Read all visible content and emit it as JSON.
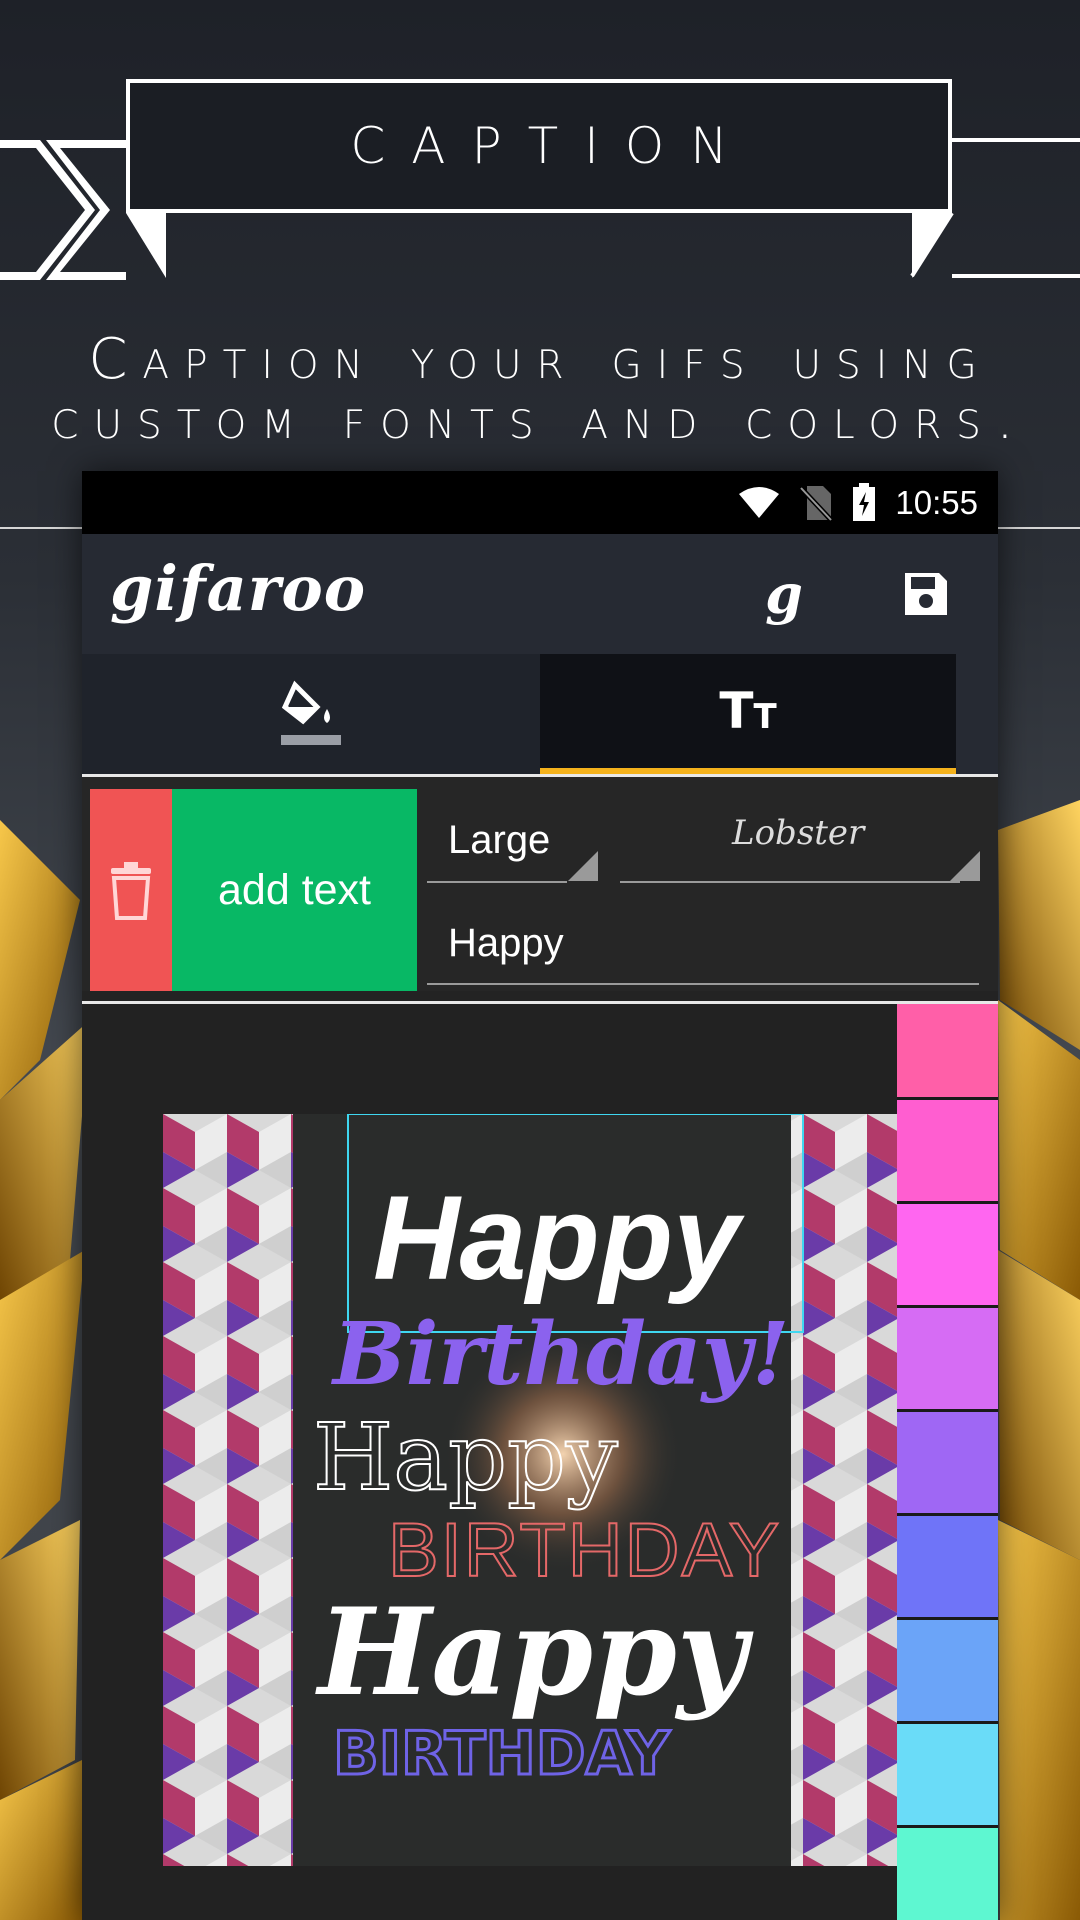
{
  "banner": {
    "title": "CAPTION"
  },
  "tagline": {
    "line1": "Caption your gifs using",
    "line2": "custom fonts and colors."
  },
  "status_bar": {
    "time": "10:55",
    "icons": [
      "wifi-icon",
      "no-sim-icon",
      "battery-charging-icon"
    ]
  },
  "app_bar": {
    "logo": "gifaroo",
    "actions": [
      {
        "icon": "gifaroo-g-icon"
      },
      {
        "icon": "save-icon"
      }
    ]
  },
  "tabs": [
    {
      "icon": "paint-bucket-icon",
      "selected": false
    },
    {
      "icon": "text-size-icon",
      "glyph": "Tт",
      "selected": true
    }
  ],
  "editor": {
    "delete_icon": "trash-icon",
    "add_label": "add text",
    "size_value": "Large",
    "font_value": "Lobster",
    "text_value": "Happy"
  },
  "preview": {
    "captions": [
      {
        "text": "Happy",
        "color": "#ffffff"
      },
      {
        "text": "Birthday!",
        "color": "#8b62ee"
      },
      {
        "text": "Happy",
        "color": "#ffffff"
      },
      {
        "text": "BIRTHDAY",
        "color": "#e46868"
      },
      {
        "text": "Happy",
        "color": "#ffffff"
      },
      {
        "text": "BIRTHDAY",
        "color": "#6f63e6"
      }
    ]
  },
  "palette": {
    "colors": [
      "#ff5fa8",
      "#ff5ed0",
      "#ff66f0",
      "#d66cf4",
      "#9f67f4",
      "#6f74f8",
      "#6ba4f8",
      "#6adcf8",
      "#5ef7d1"
    ]
  },
  "accent": "#f4b21c"
}
